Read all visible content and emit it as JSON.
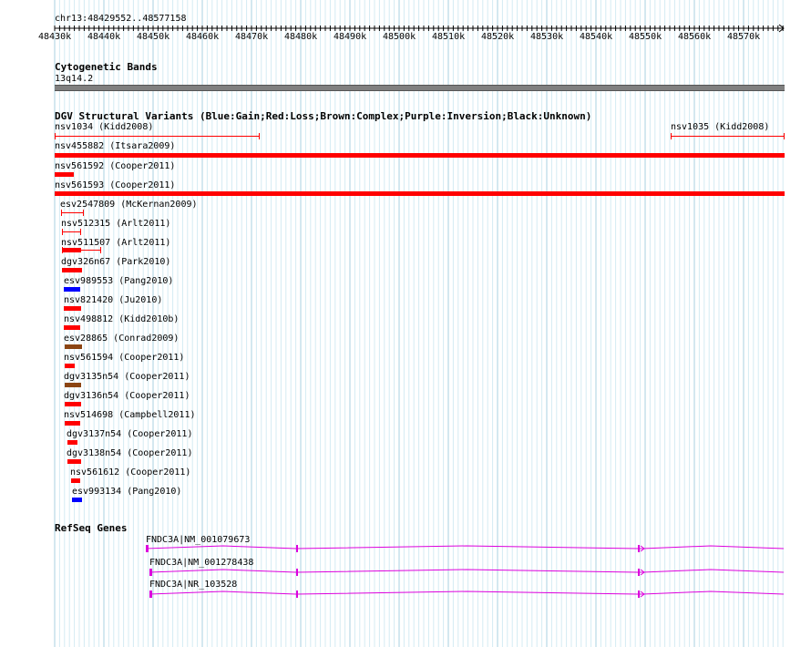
{
  "ruler": {
    "region": "chr13:48429552..48577158",
    "ticks": [
      "48430k",
      "48440k",
      "48450k",
      "48460k",
      "48470k",
      "48480k",
      "48490k",
      "48500k",
      "48510k",
      "48520k",
      "48530k",
      "48540k",
      "48550k",
      "48560k",
      "48570k"
    ]
  },
  "cytoband": {
    "title": "Cytogenetic Bands",
    "band": "13q14.2"
  },
  "dgv": {
    "title": "DGV Structural Variants (Blue:Gain;Red:Loss;Brown:Complex;Purple:Inversion;Black:Unknown)",
    "colors": {
      "gain": "#0000ff",
      "loss": "#ff0000",
      "complex": "#8b4513",
      "inversion": "#800080",
      "unknown": "#000000"
    },
    "features": [
      {
        "label": "nsv1034 (Kidd2008)",
        "type": "loss",
        "style": "line"
      },
      {
        "label": "nsv1035 (Kidd2008)",
        "type": "loss",
        "style": "line"
      },
      {
        "label": "nsv455882 (Itsara2009)",
        "type": "loss",
        "style": "box"
      },
      {
        "label": "nsv561592 (Cooper2011)",
        "type": "loss",
        "style": "box"
      },
      {
        "label": "nsv561593 (Cooper2011)",
        "type": "loss",
        "style": "box"
      },
      {
        "label": "esv2547809 (McKernan2009)",
        "type": "loss",
        "style": "line"
      },
      {
        "label": "nsv512315 (Arlt2011)",
        "type": "loss",
        "style": "line"
      },
      {
        "label": "nsv511507 (Arlt2011)",
        "type": "loss",
        "style": "mixed"
      },
      {
        "label": "dgv326n67 (Park2010)",
        "type": "loss",
        "style": "box"
      },
      {
        "label": "esv989553 (Pang2010)",
        "type": "gain",
        "style": "box"
      },
      {
        "label": "nsv821420 (Ju2010)",
        "type": "loss",
        "style": "box"
      },
      {
        "label": "nsv498812 (Kidd2010b)",
        "type": "loss",
        "style": "box"
      },
      {
        "label": "esv28865 (Conrad2009)",
        "type": "complex",
        "style": "box"
      },
      {
        "label": "nsv561594 (Cooper2011)",
        "type": "loss",
        "style": "box"
      },
      {
        "label": "dgv3135n54 (Cooper2011)",
        "type": "complex",
        "style": "box"
      },
      {
        "label": "dgv3136n54 (Cooper2011)",
        "type": "loss",
        "style": "box"
      },
      {
        "label": "nsv514698 (Campbell2011)",
        "type": "loss",
        "style": "box"
      },
      {
        "label": "dgv3137n54 (Cooper2011)",
        "type": "loss",
        "style": "box"
      },
      {
        "label": "dgv3138n54 (Cooper2011)",
        "type": "loss",
        "style": "box"
      },
      {
        "label": "nsv561612 (Cooper2011)",
        "type": "loss",
        "style": "box"
      },
      {
        "label": "esv993134 (Pang2010)",
        "type": "gain",
        "style": "box"
      }
    ]
  },
  "refseq": {
    "title": "RefSeq Genes",
    "color": "#dd00dd",
    "genes": [
      {
        "label": "FNDC3A|NM_001079673"
      },
      {
        "label": "FNDC3A|NM_001278438"
      },
      {
        "label": "FNDC3A|NR_103528"
      }
    ]
  }
}
